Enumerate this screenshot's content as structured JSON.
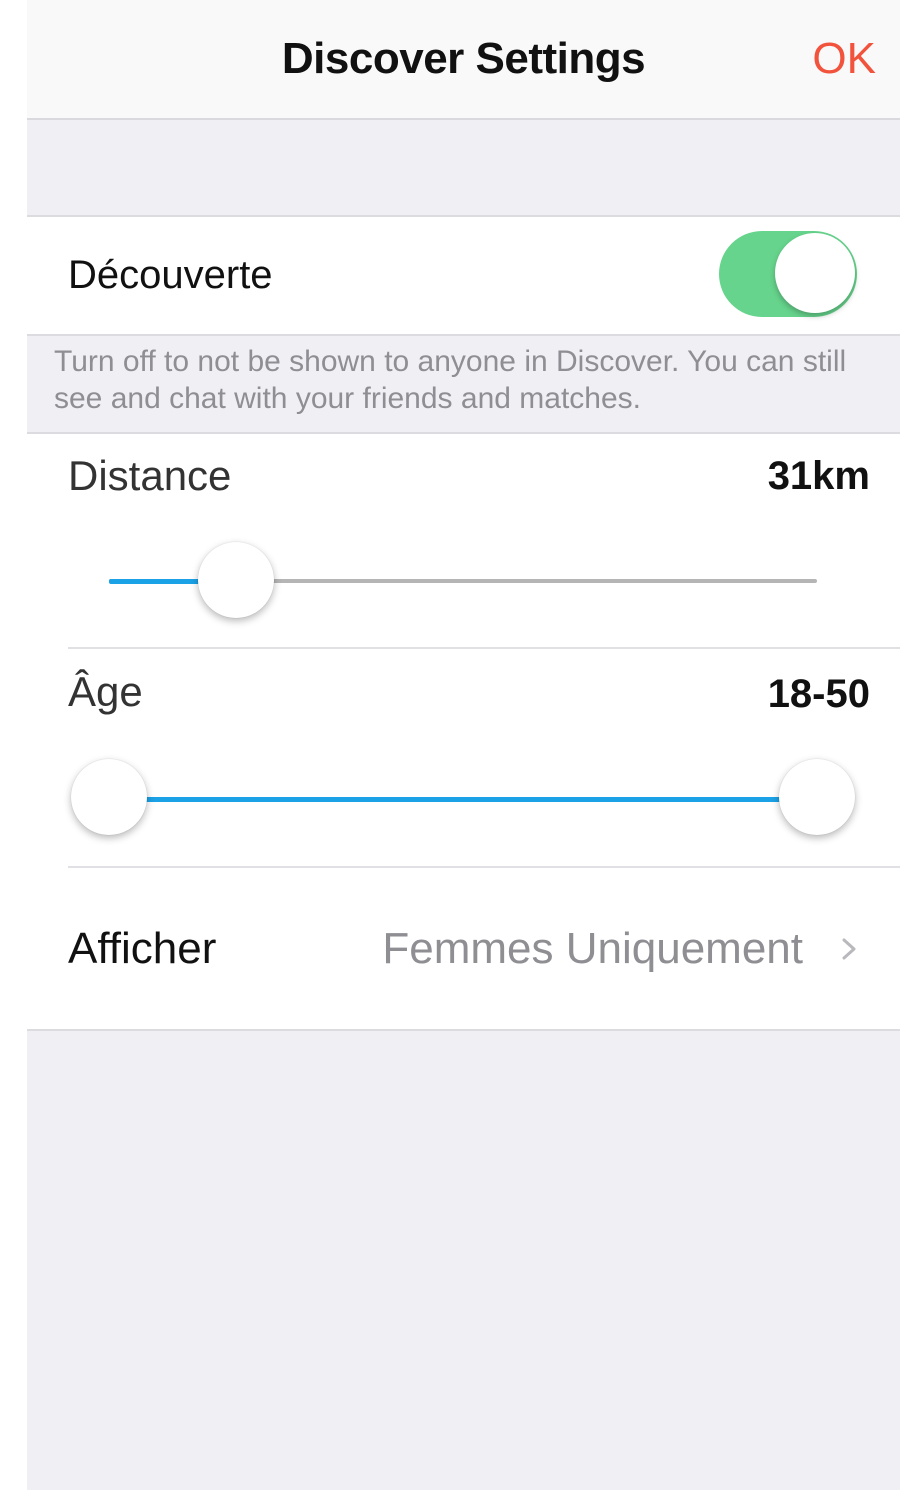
{
  "navbar": {
    "title": "Discover Settings",
    "ok_label": "OK",
    "ok_color": "#f2533c"
  },
  "discover": {
    "label": "Découverte",
    "enabled": true,
    "toggle_color": "#66d48c",
    "footnote": "Turn off to not be shown to anyone in Discover. You can still see and chat with your friends and matches."
  },
  "distance": {
    "label": "Distance",
    "value_text": "31km",
    "fill_fraction": 0.18
  },
  "age": {
    "label": "Âge",
    "value_text": "18-50",
    "min_fraction": 0.0,
    "max_fraction": 1.0
  },
  "show": {
    "label": "Afficher",
    "value": "Femmes Uniquement",
    "icon": "chevron-right-icon"
  },
  "colors": {
    "slider_fill": "#1ba1e6",
    "background": "#efeff4"
  }
}
